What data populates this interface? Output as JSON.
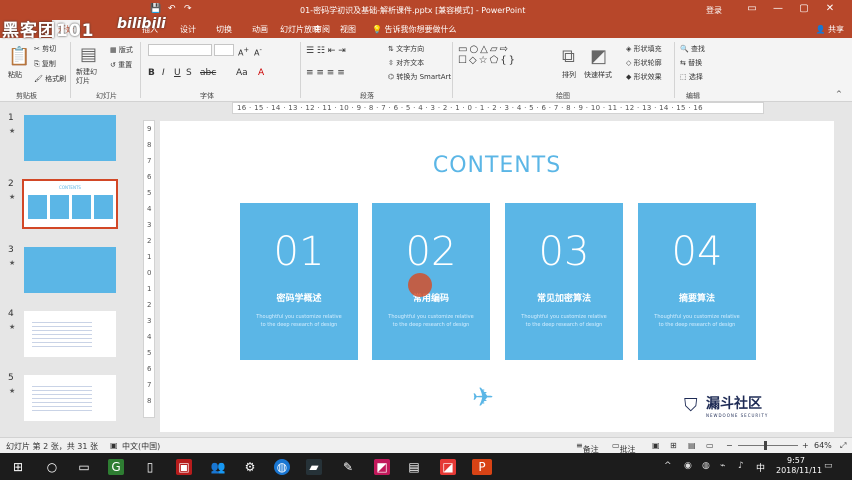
{
  "titlebar": {
    "title": "01-密码学初识及基础-解析课件.pptx [兼容模式] - PowerPoint",
    "user": "登录"
  },
  "watermark": {
    "text": "黑客团101",
    "bili": "bilibili"
  },
  "tabs": {
    "items": [
      "开始",
      "插入",
      "设计",
      "切换",
      "动画",
      "幻灯片放映",
      "审阅",
      "视图",
      "帮助"
    ],
    "tellme": "告诉我你想要做什么",
    "share": "共享"
  },
  "ribbon": {
    "groups": [
      "剪贴板",
      "幻灯片",
      "字体",
      "段落",
      "绘图",
      "编辑"
    ],
    "paste": "粘贴",
    "cut": "剪切",
    "copy": "复制",
    "format_painter": "格式刷",
    "new_slide": "新建幻灯片",
    "layout": "版式",
    "reset": "重置",
    "section": "节",
    "text_direction": "文字方向",
    "align_text": "对齐文本",
    "smartart": "转换为 SmartArt",
    "arrange": "排列",
    "quick_styles": "快速样式",
    "shape_fill": "形状填充",
    "shape_outline": "形状轮廓",
    "shape_effects": "形状效果",
    "find": "查找",
    "replace": "替换",
    "select": "选择"
  },
  "ruler": {
    "h": "16 · 15 · 14 · 13 · 12 · 11 · 10 · 9 · 8 · 7 · 6 · 5 · 4 · 3 · 2 · 1 · 0 · 1 · 2 · 3 · 4 · 5 · 6 · 7 · 8 · 9 · 10 · 11 · 12 · 13 · 14 · 15 · 16",
    "v": [
      "9",
      "8",
      "7",
      "6",
      "5",
      "4",
      "3",
      "2",
      "1",
      "0",
      "1",
      "2",
      "3",
      "4",
      "5",
      "6",
      "7",
      "8",
      "9"
    ]
  },
  "thumbnails": [
    "1",
    "2",
    "3",
    "4",
    "5"
  ],
  "slide": {
    "heading": "CONTENTS",
    "cards": [
      {
        "num": "01",
        "name": "密码学概述",
        "desc": "Thoughtful you customize relative to the deep research of design"
      },
      {
        "num": "02",
        "name": "常用编码",
        "desc": "Thoughtful you customize relative to the deep research of design"
      },
      {
        "num": "03",
        "name": "常见加密算法",
        "desc": "Thoughtful you customize relative to the deep research of design"
      },
      {
        "num": "04",
        "name": "摘要算法",
        "desc": "Thoughtful you customize relative to the deep research of design"
      }
    ],
    "brand_main": "漏斗社区",
    "brand_sub": "NEWDOONE SECURITY"
  },
  "status": {
    "slide_info": "幻灯片 第 2 张，共 31 张",
    "language": "中文(中国)",
    "notes": "备注",
    "comments": "批注",
    "zoom": "64%"
  },
  "taskbar": {
    "time": "9:57",
    "date": "2018/11/11",
    "lang": "中"
  },
  "colors": {
    "accent": "#5bb6e6",
    "ppt": "#b7472a",
    "cursor": "#d2502c"
  }
}
